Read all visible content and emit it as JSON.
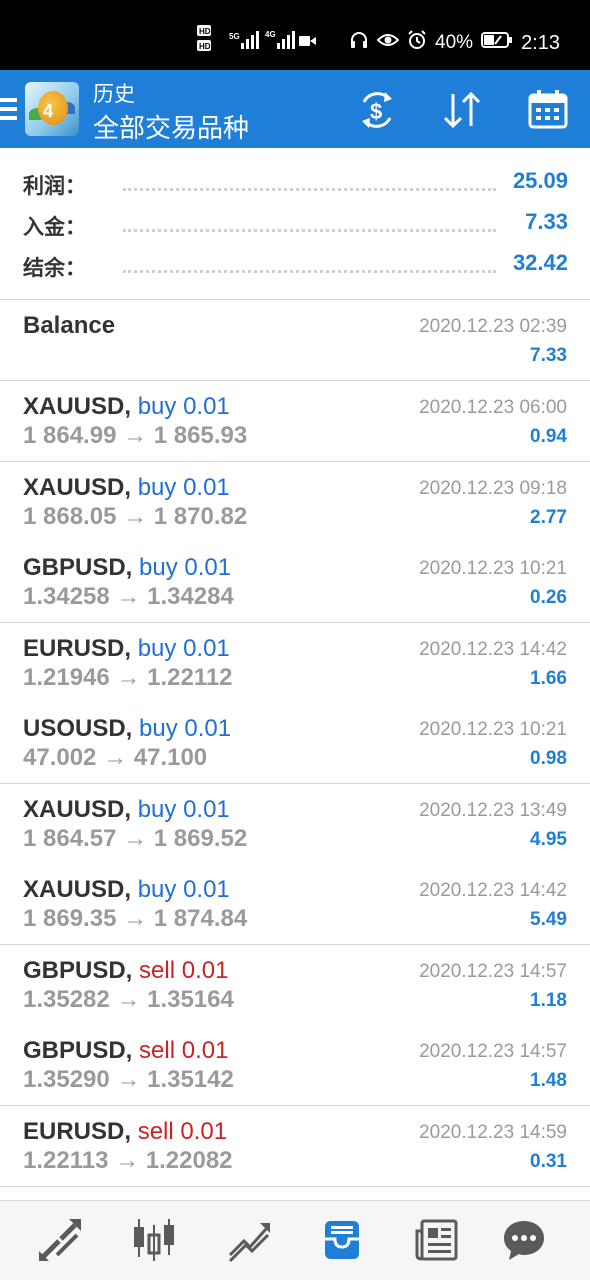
{
  "status_bar": {
    "network_label": "HD 5G 4G",
    "battery": "40%",
    "time": "2:13"
  },
  "app_bar": {
    "subtitle": "历史",
    "title": "全部交易品种",
    "icons": [
      "menu-icon",
      "mt4-logo",
      "currency-exchange-icon",
      "sort-icon",
      "calendar-icon"
    ]
  },
  "summary": {
    "profit_label": "利润：",
    "profit_value": "25.09",
    "deposit_label": "入金：",
    "deposit_value": "7.33",
    "balance_label": "结余：",
    "balance_value": "32.42"
  },
  "deals": [
    {
      "symbol": "Balance",
      "side": "",
      "volume": "",
      "prices": "",
      "date": "2020.12.23 02:39",
      "profit": "7.33"
    },
    {
      "symbol": "XAUUSD,",
      "side": "buy",
      "volume": "0.01",
      "prices": "1 864.99 → 1 865.93",
      "date": "2020.12.23 06:00",
      "profit": "0.94"
    },
    {
      "symbol": "XAUUSD,",
      "side": "buy",
      "volume": "0.01",
      "prices": "1 868.05 → 1 870.82",
      "date": "2020.12.23 09:18",
      "profit": "2.77"
    },
    {
      "symbol": "GBPUSD,",
      "side": "buy",
      "volume": "0.01",
      "prices": "1.34258 → 1.34284",
      "date": "2020.12.23 10:21",
      "profit": "0.26"
    },
    {
      "symbol": "EURUSD,",
      "side": "buy",
      "volume": "0.01",
      "prices": "1.21946 → 1.22112",
      "date": "2020.12.23 14:42",
      "profit": "1.66"
    },
    {
      "symbol": "USOUSD,",
      "side": "buy",
      "volume": "0.01",
      "prices": "47.002 → 47.100",
      "date": "2020.12.23 10:21",
      "profit": "0.98"
    },
    {
      "symbol": "XAUUSD,",
      "side": "buy",
      "volume": "0.01",
      "prices": "1 864.57 → 1 869.52",
      "date": "2020.12.23 13:49",
      "profit": "4.95"
    },
    {
      "symbol": "XAUUSD,",
      "side": "buy",
      "volume": "0.01",
      "prices": "1 869.35 → 1 874.84",
      "date": "2020.12.23 14:42",
      "profit": "5.49"
    },
    {
      "symbol": "GBPUSD,",
      "side": "sell",
      "volume": "0.01",
      "prices": "1.35282 → 1.35164",
      "date": "2020.12.23 14:57",
      "profit": "1.18"
    },
    {
      "symbol": "GBPUSD,",
      "side": "sell",
      "volume": "0.01",
      "prices": "1.35290 → 1.35142",
      "date": "2020.12.23 14:57",
      "profit": "1.48"
    },
    {
      "symbol": "EURUSD,",
      "side": "sell",
      "volume": "0.01",
      "prices": "1.22113 → 1.22082",
      "date": "2020.12.23 14:59",
      "profit": "0.31"
    }
  ],
  "bottom_nav": {
    "items": [
      {
        "icon": "quotes-icon",
        "active": false
      },
      {
        "icon": "chart-candles-icon",
        "active": false
      },
      {
        "icon": "trade-icon",
        "active": false
      },
      {
        "icon": "history-icon",
        "active": true
      },
      {
        "icon": "news-icon",
        "active": false
      },
      {
        "icon": "chat-icon",
        "active": false
      }
    ]
  },
  "colors": {
    "accent": "#1f7fd8",
    "buy": "#1f6fd6",
    "sell": "#cc2222",
    "muted": "#9a9a9a",
    "nav_inactive": "#5a5a5a"
  }
}
